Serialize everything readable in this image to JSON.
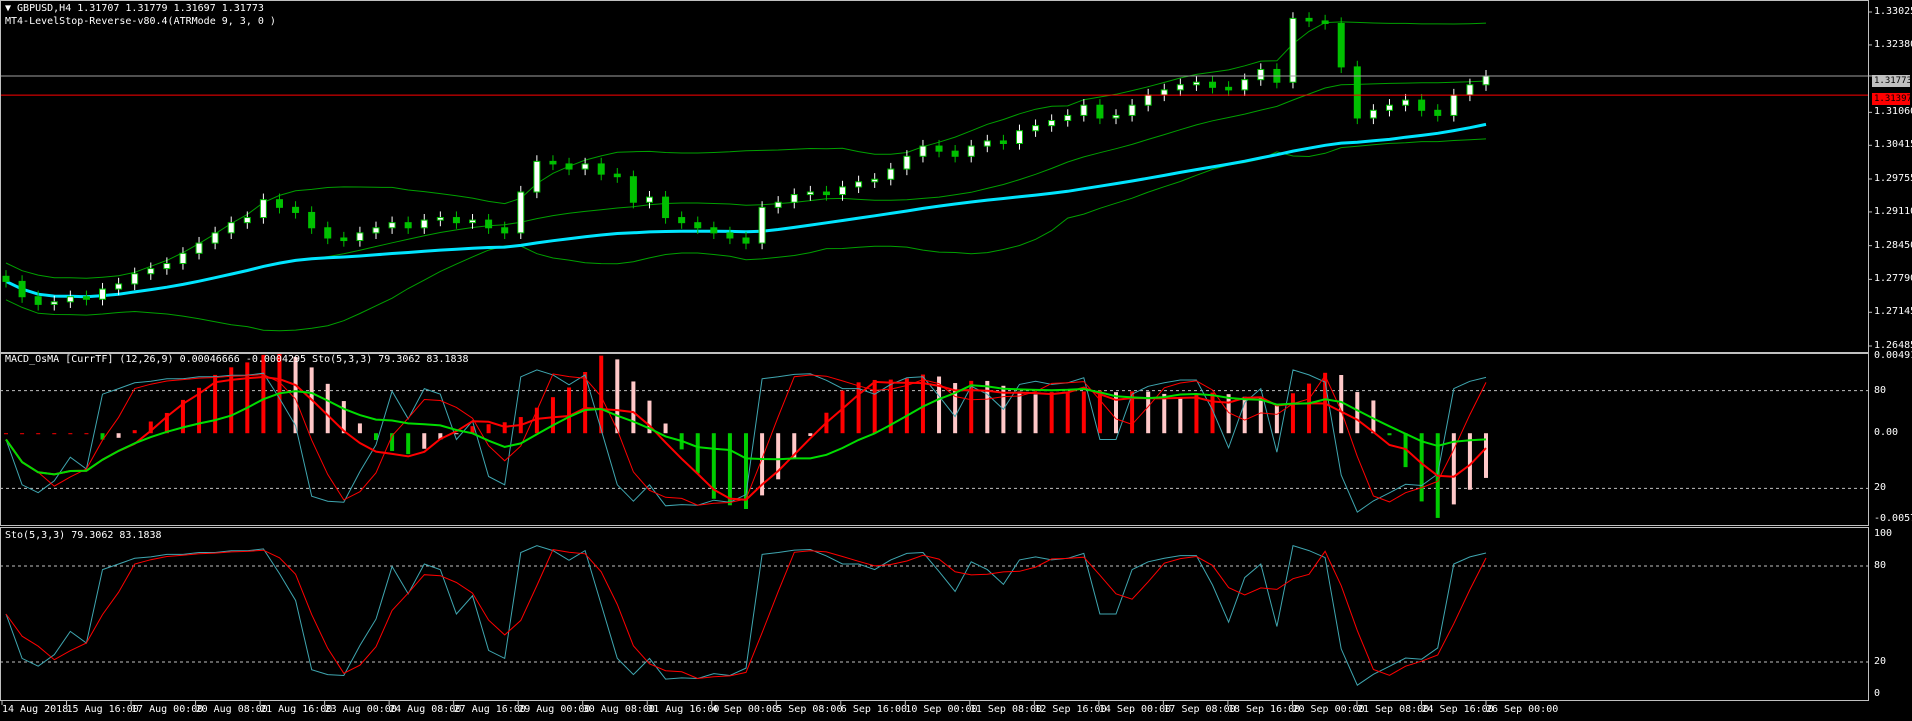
{
  "main_title": "▼ GBPUSD,H4  1.31707 1.31779 1.31697 1.31773",
  "indicator_title": "MT4-LevelStop-Reverse-v80.4(ATRMode 9, 3, 0 )",
  "macd_title": "MACD_OsMA [CurrTF] (12,26,9) 0.00046666 -0.0004295  Sto(5,3,3) 79.3062 83.1838",
  "sto_title": "Sto(5,3,3) 79.3062 83.1838",
  "current_price": "1.31773",
  "red_level_price": "1.31397",
  "price_axis": [
    "1.33025",
    "1.32380",
    "1.31773",
    "1.31060",
    "1.30415",
    "1.29755",
    "1.29110",
    "1.28450",
    "1.27790",
    "1.27145",
    "1.26485"
  ],
  "macd_axis": [
    "0.004913",
    "80",
    "0.00",
    "20",
    "-0.005734"
  ],
  "sto_axis": [
    "100",
    "80",
    "20",
    "0"
  ],
  "time_axis": [
    "14 Aug 2018",
    "15 Aug 16:00",
    "17 Aug 00:00",
    "20 Aug 08:00",
    "21 Aug 16:00",
    "23 Aug 00:00",
    "24 Aug 08:00",
    "27 Aug 16:00",
    "29 Aug 00:00",
    "30 Aug 08:00",
    "31 Aug 16:00",
    "4 Sep 00:00",
    "5 Sep 08:00",
    "6 Sep 16:00",
    "10 Sep 00:00",
    "11 Sep 08:00",
    "12 Sep 16:00",
    "14 Sep 00:00",
    "17 Sep 08:00",
    "18 Sep 16:00",
    "20 Sep 00:00",
    "21 Sep 08:00",
    "24 Sep 16:00",
    "26 Sep 00:00"
  ],
  "colors": {
    "bull": "#ffffff",
    "bear": "#00c000",
    "ma": "#00e5ff",
    "band": "#00a000",
    "red_line": "#ff0000",
    "macd_up": "#ff0000",
    "macd_down": "#00cc00",
    "macd_weak": "#ffc8c8",
    "sig_red": "#ff0000",
    "sig_green": "#00dd00",
    "sto_main": "#3fa6b0",
    "sto_sig": "#ff0000",
    "grid": "#c0c0c0"
  },
  "chart_data": [
    {
      "type": "candlestick",
      "title": "GBPUSD,H4",
      "ylim": [
        1.26485,
        1.33025
      ],
      "close": [
        1.2775,
        1.2745,
        1.273,
        1.2735,
        1.2745,
        1.274,
        1.276,
        1.277,
        1.279,
        1.28,
        1.281,
        1.283,
        1.285,
        1.287,
        1.289,
        1.29,
        1.2935,
        1.292,
        1.291,
        1.288,
        1.286,
        1.2855,
        1.287,
        1.288,
        1.289,
        1.288,
        1.2895,
        1.29,
        1.289,
        1.2895,
        1.288,
        1.287,
        1.295,
        1.301,
        1.3005,
        1.2995,
        1.3005,
        1.2985,
        1.298,
        1.293,
        1.294,
        1.29,
        1.289,
        1.288,
        1.287,
        1.286,
        1.285,
        1.292,
        1.293,
        1.2945,
        1.295,
        1.2945,
        1.296,
        1.297,
        1.2975,
        1.2995,
        1.302,
        1.304,
        1.303,
        1.302,
        1.304,
        1.305,
        1.3045,
        1.307,
        1.308,
        1.309,
        1.31,
        1.312,
        1.3095,
        1.31,
        1.312,
        1.314,
        1.315,
        1.316,
        1.3165,
        1.3155,
        1.315,
        1.317,
        1.319,
        1.3165,
        1.329,
        1.3285,
        1.328,
        1.3195,
        1.3095,
        1.311,
        1.312,
        1.313,
        1.311,
        1.31,
        1.314,
        1.316,
        1.3177
      ]
    },
    {
      "type": "bar",
      "title": "MACD_OsMA",
      "ylim": [
        -0.005734,
        0.004913
      ]
    },
    {
      "type": "line",
      "title": "Sto(5,3,3)",
      "ylim": [
        0,
        100
      ],
      "values": [
        79.3062,
        83.1838
      ]
    }
  ]
}
